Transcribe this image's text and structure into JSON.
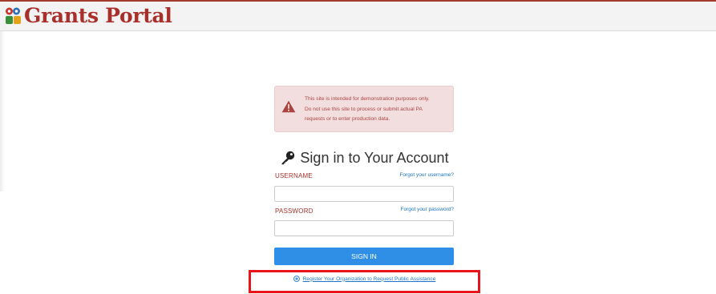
{
  "header": {
    "logo_text": "Grants Portal",
    "brand_color": "#a9302a"
  },
  "warning": {
    "icon": "warning-triangle-icon",
    "lines": [
      "This site is intended for demonstration purposes only.",
      "Do not use this site to process or submit actual PA",
      "requests or to enter production data."
    ]
  },
  "login": {
    "title_icon": "key-icon",
    "title": "Sign in to Your Account",
    "username_label": "USERNAME",
    "forgot_username": "Forgot your username?",
    "username_value": "",
    "password_label": "PASSWORD",
    "forgot_password": "Forgot your password?",
    "password_value": "",
    "sign_in_label": "SIGN IN",
    "accent_color": "#2f8fe6"
  },
  "register": {
    "icon": "plus-circle-icon",
    "label": "Register Your Organization to Request Public Assistance",
    "highlight_color": "#e8161b"
  }
}
